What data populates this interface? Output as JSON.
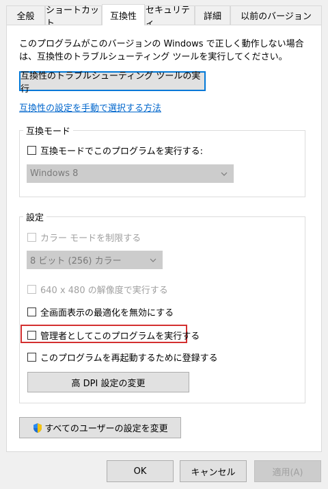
{
  "tabs": [
    {
      "label": "全般"
    },
    {
      "label": "ショートカット"
    },
    {
      "label": "互換性"
    },
    {
      "label": "セキュリティ"
    },
    {
      "label": "詳細"
    },
    {
      "label": "以前のバージョン"
    }
  ],
  "description": "このプログラムがこのバージョンの Windows で正しく動作しない場合は、互換性のトラブルシューティング ツールを実行してください。",
  "troubleshoot_button": "互換性のトラブルシューティング ツールの実行",
  "manual_link": "互換性の設定を手動で選択する方法",
  "compat_mode": {
    "label": "互換モード",
    "checkbox": "互換モードでこのプログラムを実行する:",
    "select_value": "Windows 8"
  },
  "settings": {
    "label": "設定",
    "reduced_color": "カラー モードを制限する",
    "color_select": "8 ビット (256) カラー",
    "resolution": "640 x 480 の解像度で実行する",
    "fullscreen": "全画面表示の最適化を無効にする",
    "admin": "管理者としてこのプログラムを実行する",
    "register_restart": "このプログラムを再起動するために登録する",
    "dpi_button": "高 DPI 設定の変更"
  },
  "all_users_button": "すべてのユーザーの設定を変更",
  "footer": {
    "ok": "OK",
    "cancel": "キャンセル",
    "apply": "適用(A)"
  },
  "colors": {
    "highlight": "#d32f2f",
    "link": "#0066cc",
    "focus": "#0078d7"
  }
}
